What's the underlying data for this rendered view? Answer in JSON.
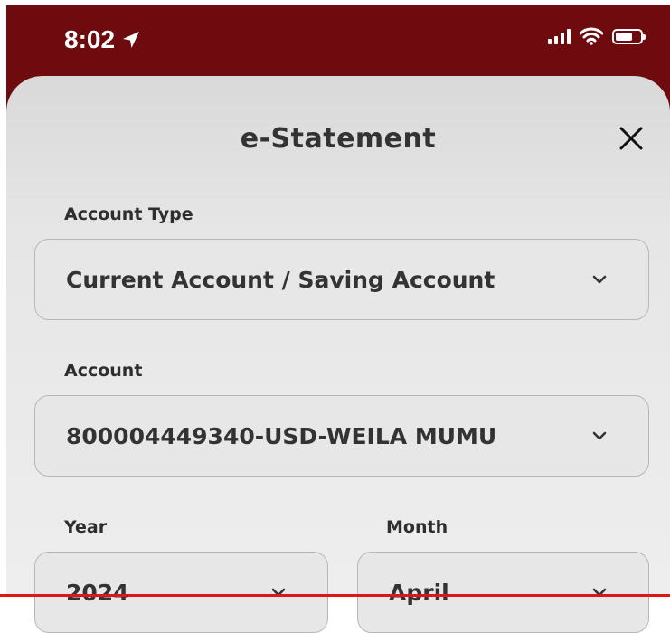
{
  "status_bar": {
    "time": "8:02",
    "background": "#6e0b0f"
  },
  "sheet": {
    "title": "e-Statement"
  },
  "fields": {
    "account_type": {
      "label": "Account Type",
      "value": "Current Account / Saving Account"
    },
    "account": {
      "label": "Account",
      "value": "800004449340-USD-WEILA MUMU"
    },
    "year": {
      "label": "Year",
      "value": "2024"
    },
    "month": {
      "label": "Month",
      "value": "April"
    }
  },
  "icons": {
    "location": "location-arrow-icon",
    "signal": "cellular-signal-icon",
    "wifi": "wifi-icon",
    "battery": "battery-icon",
    "close": "close-icon",
    "dropdown": "chevron-down-icon"
  },
  "colors": {
    "accent": "#6e0b0f",
    "sheet": "#e6e6e6",
    "text": "#333333",
    "bottom_line": "#e01515"
  }
}
